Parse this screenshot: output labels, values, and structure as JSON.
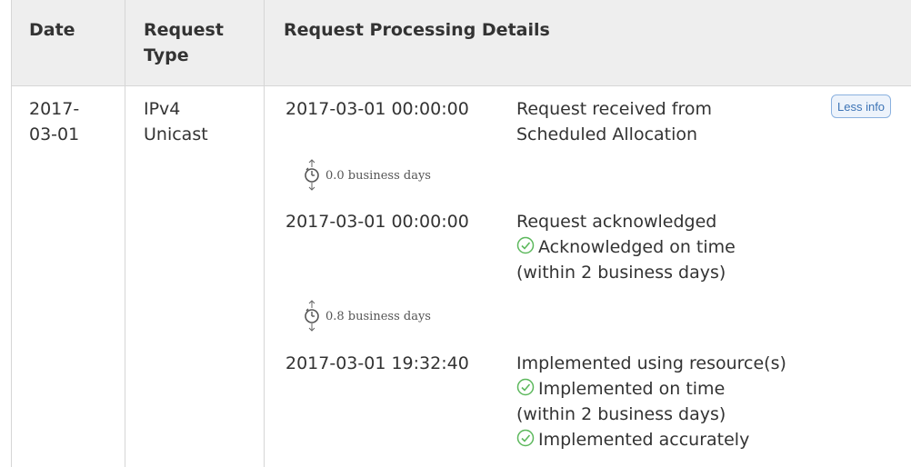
{
  "columns": {
    "date": "Date",
    "type": "Request\nType",
    "details": "Request Processing Details"
  },
  "row": {
    "date": "2017-\n03-01",
    "type": "IPv4\nUnicast",
    "toggle_label": "Less info",
    "events": [
      {
        "timestamp": "2017-03-01 00:00:00",
        "lines": [
          {
            "text": "Request received from",
            "check": false
          },
          {
            "text": "Scheduled Allocation",
            "check": false
          }
        ]
      },
      {
        "timestamp": "2017-03-01 00:00:00",
        "lines": [
          {
            "text": "Request acknowledged",
            "check": false
          },
          {
            "text": "Acknowledged on time",
            "check": true
          },
          {
            "text": "(within 2 business days)",
            "check": false
          }
        ]
      },
      {
        "timestamp": "2017-03-01 19:32:40",
        "lines": [
          {
            "text": "Implemented using resource(s)",
            "check": false
          },
          {
            "text": "Implemented on time",
            "check": true
          },
          {
            "text": "(within 2 business days)",
            "check": false
          },
          {
            "text": "Implemented accurately",
            "check": true
          }
        ]
      }
    ],
    "gaps": [
      "0.0 business days",
      "0.8 business days"
    ]
  },
  "colors": {
    "header_bg": "#eeeeee",
    "border": "#d6d6d6",
    "check": "#5cb85c",
    "button_text": "#3d74b6"
  },
  "icons": [
    "check-circle-icon",
    "stopwatch-icon"
  ]
}
